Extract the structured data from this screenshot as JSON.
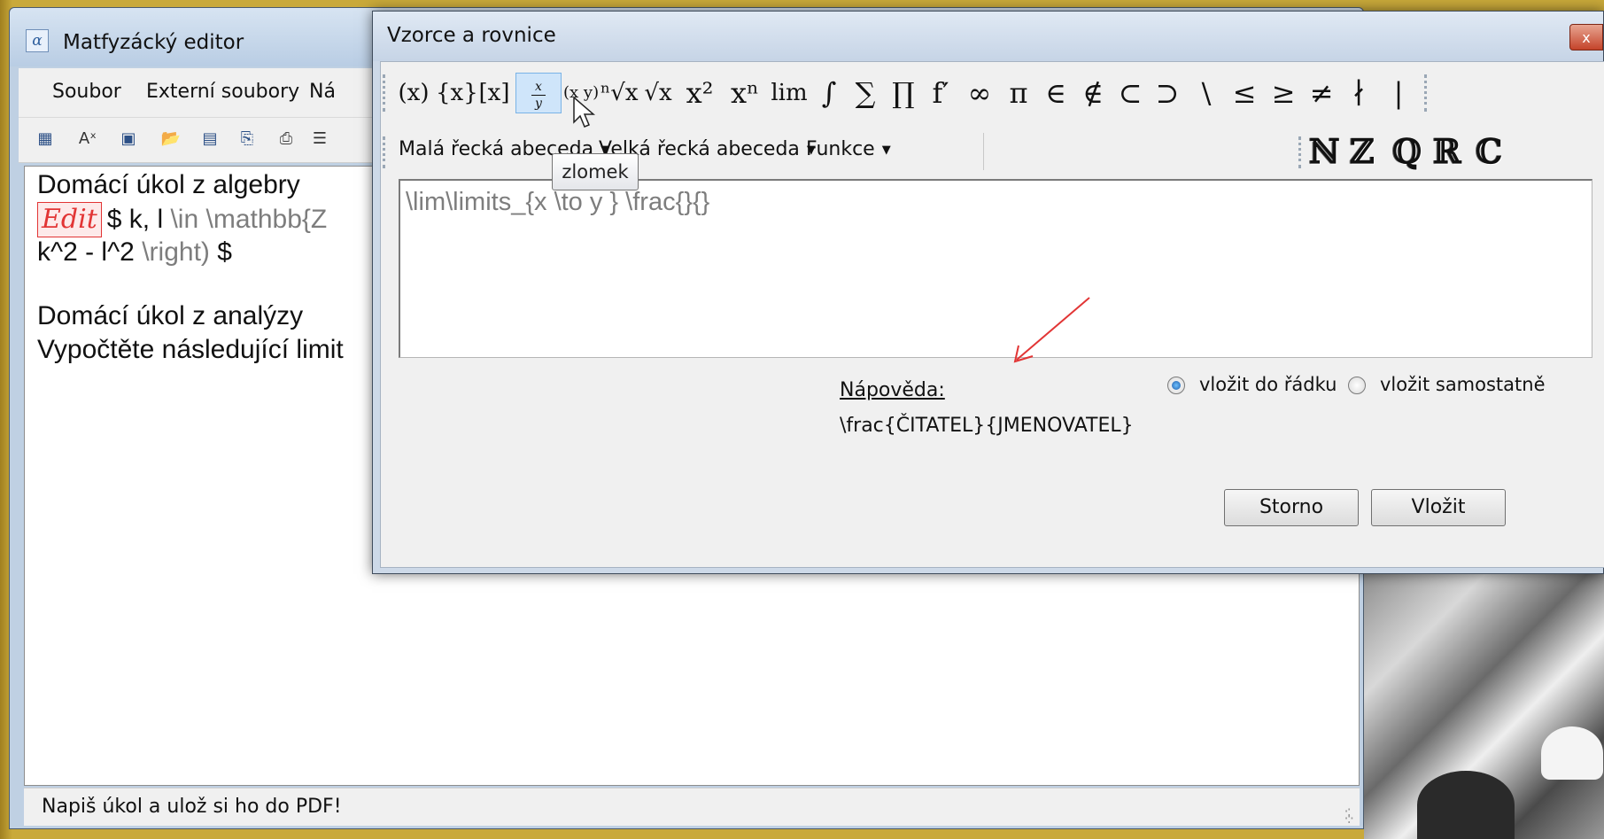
{
  "main_window": {
    "title": "Matfyzácký editor",
    "app_icon": "α",
    "menu": [
      "Soubor",
      "Externí soubory",
      "Ná"
    ],
    "document_lines": {
      "line1": "Domácí úkol z algebry",
      "line2_badge": "Edit",
      "line2_a": "$ k, l",
      "line2_b": "\\in  \\mathbb{Z",
      "line3_a": "k^2 - l^2",
      "line3_b": "\\right)",
      "line3_c": "$",
      "line4": "Domácí úkol z analýzy",
      "line5": "Vypočtěte následující limit"
    },
    "status": "Napiš úkol a ulož si ho do PDF!"
  },
  "dialog": {
    "title": "Vzorce a rovnice",
    "close_glyph": "x",
    "symbols": {
      "paren": "(x)",
      "brace": "{x}",
      "bracket": "[x]",
      "frac_num": "x",
      "frac_den": "y",
      "binom": "(x y)",
      "nroot": "ⁿ√x",
      "sqrt": "√x",
      "square": "x²",
      "power": "xⁿ",
      "lim": "lim",
      "integral": "∫",
      "sum": "∑",
      "prod": "∏",
      "derivative": "f′",
      "infinity": "∞",
      "pi": "π",
      "in": "∈",
      "notin": "∉",
      "subset": "⊂",
      "supset": "⊃",
      "setminus": "\\",
      "leq": "≤",
      "geq": "≥",
      "neq": "≠",
      "nmid": "∤",
      "mid": "|"
    },
    "categories": [
      "Malá řecká abeceda",
      "Velká řecká abeceda",
      "Funkce"
    ],
    "number_sets": [
      "ℕ",
      "ℤ",
      "ℚ",
      "ℝ",
      "ℂ"
    ],
    "formula_value": "\\lim\\limits_{x \\to y } \\frac{}{}",
    "tooltip": "zlomek",
    "help_label": "Nápověda:",
    "help_text": "\\frac{ČITATEL}{JMENOVATEL}",
    "radio_inline": "vložit do řádku",
    "radio_standalone": "vložit samostatně",
    "cancel_button": "Storno",
    "insert_button": "Vložit"
  },
  "colors": {
    "desktop": "#c9a93a",
    "accent_red": "#e23535",
    "selection": "#cfe5fa"
  }
}
